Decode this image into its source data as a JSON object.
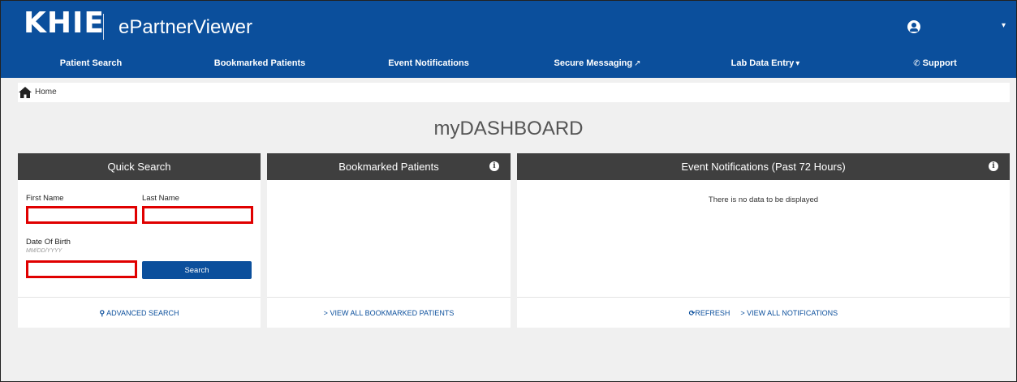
{
  "header": {
    "logo_text": "KHIE",
    "app_title": "ePartnerViewer",
    "user_icon": "user-circle-icon",
    "user_caret": "▾"
  },
  "nav": {
    "patient_search": "Patient Search",
    "bookmarked_patients": "Bookmarked Patients",
    "event_notifications": "Event Notifications",
    "secure_messaging": "Secure Messaging",
    "secure_messaging_icon": "↗",
    "lab_data_entry": "Lab Data Entry",
    "lab_data_entry_caret": "▾",
    "support": "Support",
    "support_icon": "✆"
  },
  "breadcrumb": {
    "home": "Home"
  },
  "dashboard_title": "myDASHBOARD",
  "quick_search": {
    "title": "Quick Search",
    "first_name_label": "First Name",
    "last_name_label": "Last Name",
    "dob_label": "Date Of Birth",
    "dob_hint": "MM/DD/YYYY",
    "search_button": "Search",
    "advanced_search": "ADVANCED SEARCH",
    "advanced_search_icon": "⚲"
  },
  "bookmarked": {
    "title": "Bookmarked Patients",
    "info_icon": "i",
    "view_all": "VIEW ALL BOOKMARKED PATIENTS",
    "view_all_icon": ">"
  },
  "events": {
    "title": "Event Notifications (Past 72 Hours)",
    "info_icon": "i",
    "empty_message": "There is no data to be displayed",
    "refresh": "REFRESH",
    "refresh_icon": "⟳",
    "view_all": "VIEW ALL NOTIFICATIONS",
    "view_all_icon": ">"
  },
  "colors": {
    "brand_blue": "#0b4f9c",
    "panel_header": "#3f3f3f",
    "highlight_red": "#e00000"
  }
}
